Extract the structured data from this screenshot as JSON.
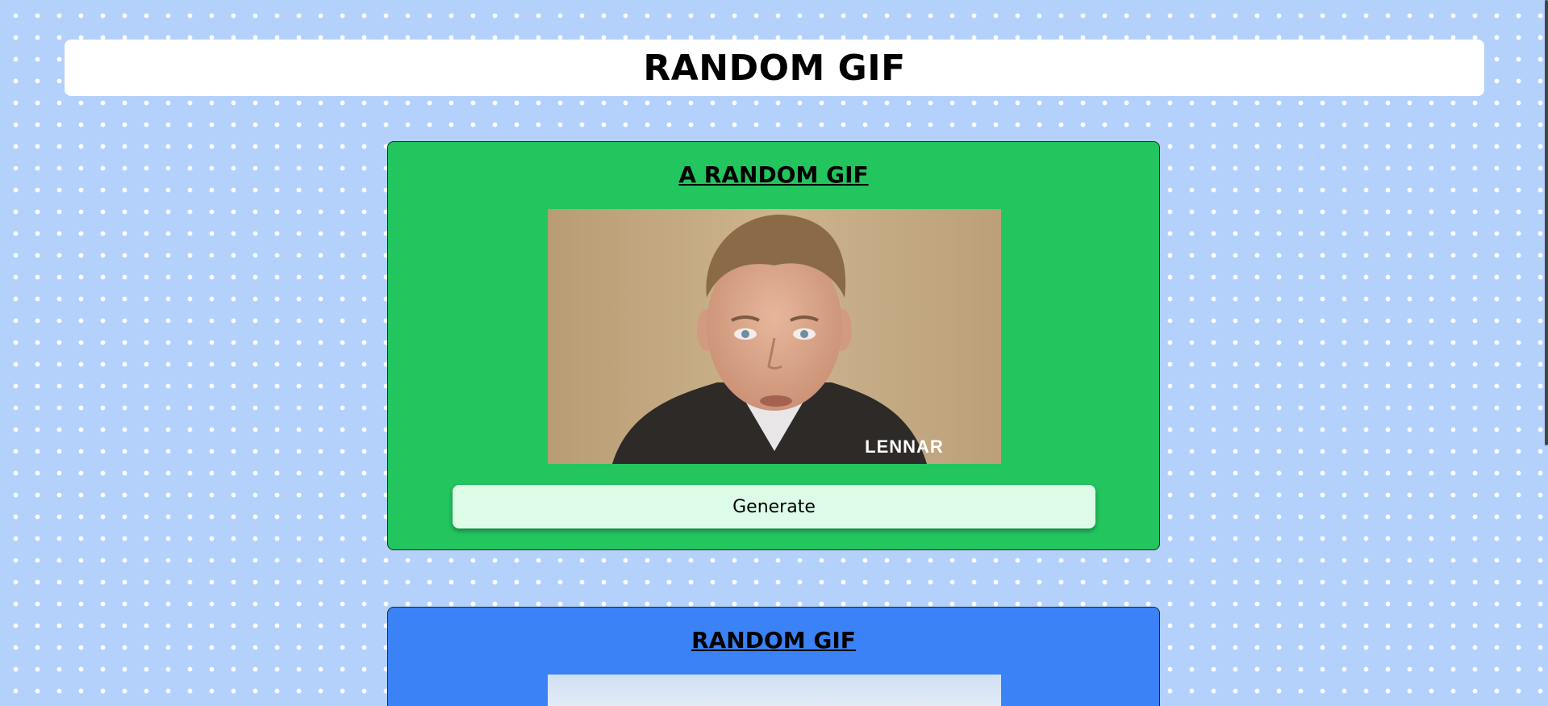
{
  "header": {
    "title": "RANDOM GIF"
  },
  "cards": [
    {
      "title": "A RANDOM GIF",
      "gif_alt": "LENNAR",
      "watermark": "LENNAR",
      "button_label": "Generate",
      "background": "#22c55e"
    },
    {
      "title": "RANDOM GIF",
      "background": "#3b82f6"
    }
  ],
  "colors": {
    "page_bg": "#b3d1fa",
    "button_bg": "#dcfce7"
  }
}
